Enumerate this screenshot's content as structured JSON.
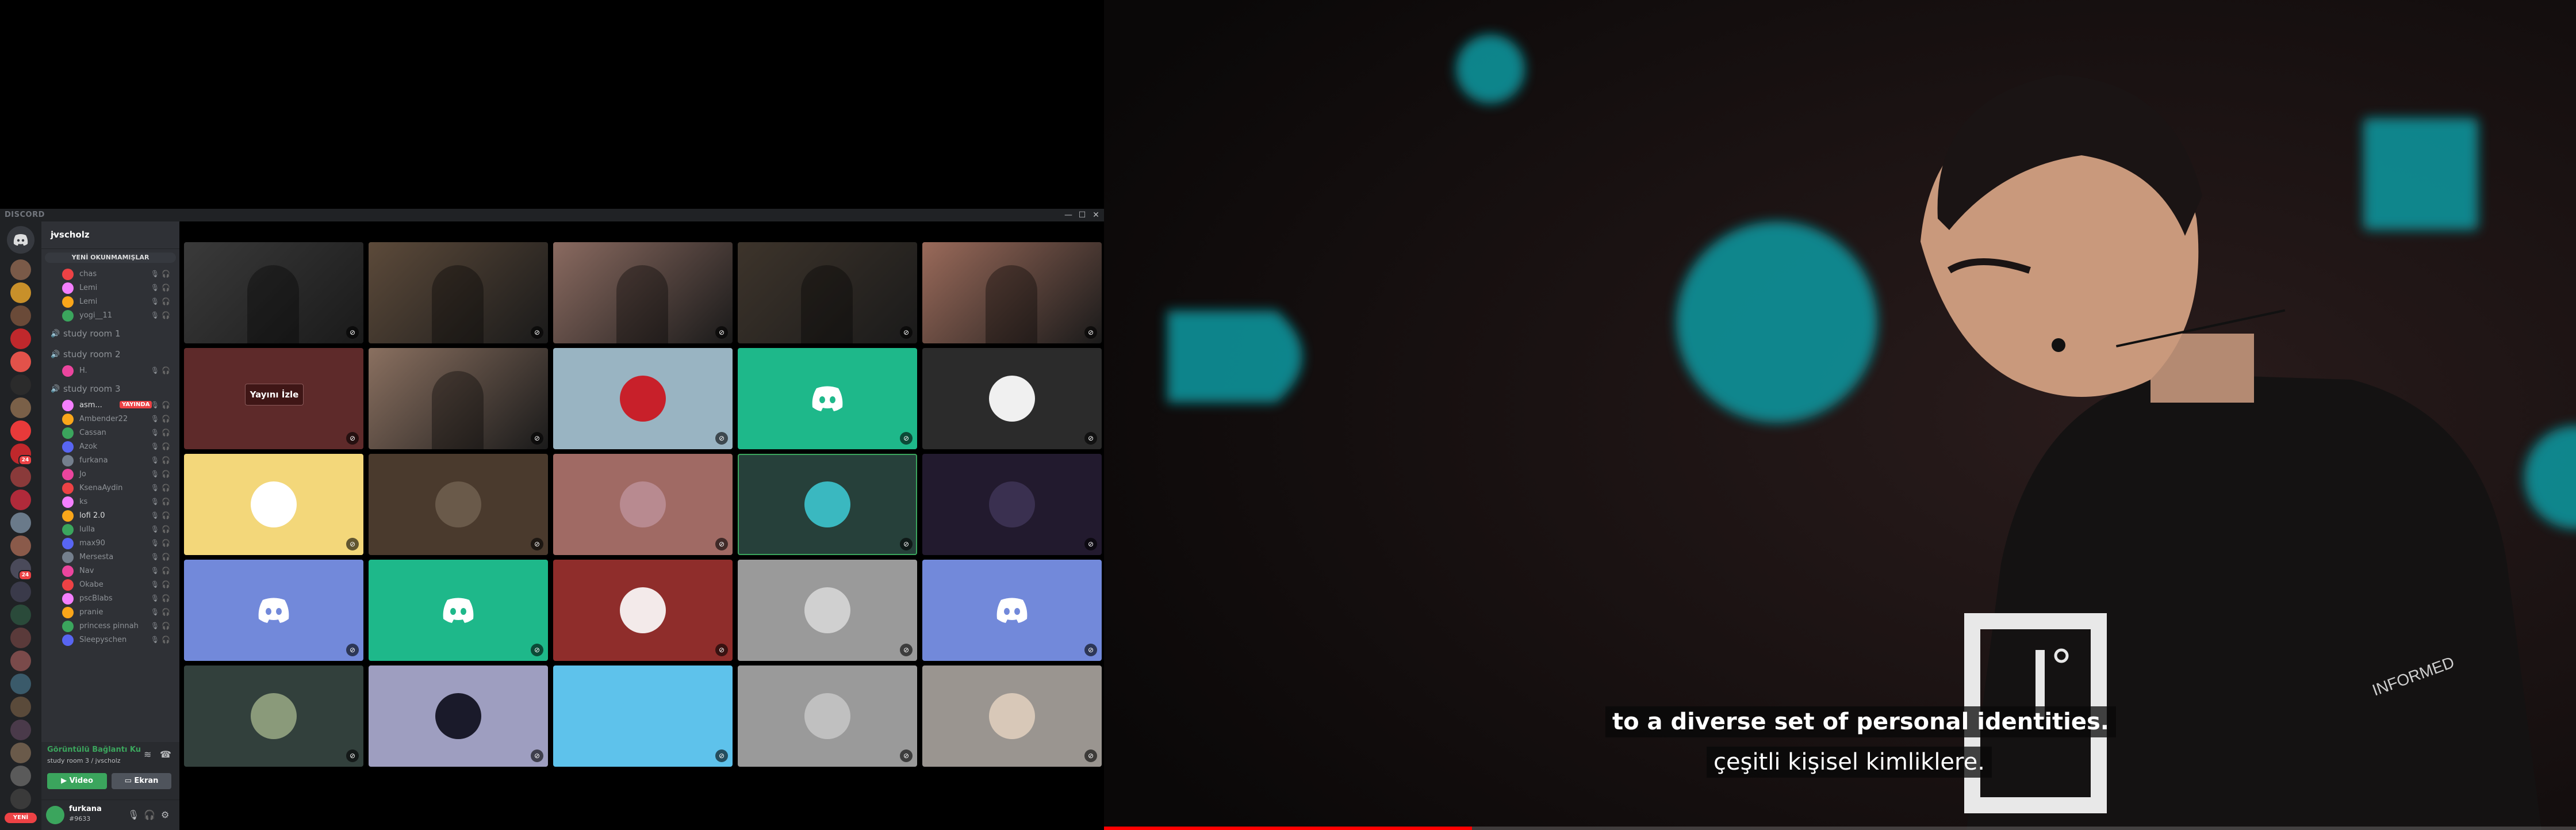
{
  "discord": {
    "app_name": "DISCORD",
    "window_controls": {
      "minimize": "—",
      "maximize": "☐",
      "close": "✕"
    },
    "server": {
      "name": "jvscholz",
      "new_unreads": "YENİ OKUNMAMIŞLAR"
    },
    "rail_badges": [
      "",
      "",
      "",
      "",
      "",
      "",
      "",
      "",
      "24",
      "",
      "",
      "",
      "",
      "24",
      "",
      "",
      "",
      "",
      "",
      "",
      "",
      "",
      "",
      ""
    ],
    "new_label": "YENİ",
    "channels": [
      {
        "type": "user",
        "name": "chas",
        "on": false
      },
      {
        "type": "user",
        "name": "Lemi",
        "on": false
      },
      {
        "type": "user",
        "name": "Lemi",
        "on": false
      },
      {
        "type": "user",
        "name": "yogi__11",
        "on": false
      },
      {
        "type": "voice",
        "name": "study room 1"
      },
      {
        "type": "voice",
        "name": "study room 2"
      },
      {
        "type": "user",
        "name": "H.",
        "on": false
      },
      {
        "type": "voice",
        "name": "study room 3"
      },
      {
        "type": "user",
        "name": "asm...",
        "on": true,
        "live": "YAYINDA"
      },
      {
        "type": "user",
        "name": "Ambender22",
        "on": false
      },
      {
        "type": "user",
        "name": "Cassan",
        "on": false
      },
      {
        "type": "user",
        "name": "Azok",
        "on": false
      },
      {
        "type": "user",
        "name": "furkana",
        "on": false
      },
      {
        "type": "user",
        "name": "Jo",
        "on": false
      },
      {
        "type": "user",
        "name": "KsenaAydin",
        "on": false
      },
      {
        "type": "user",
        "name": "ks",
        "on": false
      },
      {
        "type": "user",
        "name": "lofi 2.0",
        "on": true
      },
      {
        "type": "user",
        "name": "lulla",
        "on": false
      },
      {
        "type": "user",
        "name": "max90",
        "on": false
      },
      {
        "type": "user",
        "name": "Mersesta",
        "on": false
      },
      {
        "type": "user",
        "name": "Nav",
        "on": false
      },
      {
        "type": "user",
        "name": "Okabe",
        "on": false
      },
      {
        "type": "user",
        "name": "pscBlabs",
        "on": false
      },
      {
        "type": "user",
        "name": "pranie",
        "on": false
      },
      {
        "type": "user",
        "name": "princess pinnah",
        "on": false
      },
      {
        "type": "user",
        "name": "Sleepyschen",
        "on": false
      }
    ],
    "voice_panel": {
      "status": "Görüntülü Bağlantı Ku",
      "location": "study room 3 / jvscholz",
      "video_label": "Video",
      "screen_label": "Ekran"
    },
    "user": {
      "name": "furkana",
      "tag": "#9633"
    },
    "watch_label": "Yayını İzle",
    "tiles": [
      {
        "kind": "cam",
        "bg": "#3a3a3a"
      },
      {
        "kind": "cam",
        "bg": "#5c4a3a"
      },
      {
        "kind": "cam",
        "bg": "#8a6a60"
      },
      {
        "kind": "cam",
        "bg": "#3d342b"
      },
      {
        "kind": "cam",
        "bg": "#9a6a5a"
      },
      {
        "kind": "stream",
        "bg": "#5e2a2a"
      },
      {
        "kind": "cam",
        "bg": "#8a7060"
      },
      {
        "kind": "avatar",
        "bg": "#99b4c2",
        "av": "#c8202a"
      },
      {
        "kind": "logo",
        "bg": "#1eb88a"
      },
      {
        "kind": "avatar",
        "bg": "#2b2b2b",
        "av": "#f0f0f0"
      },
      {
        "kind": "avatar",
        "bg": "#f3d77a",
        "av": "#ffffff"
      },
      {
        "kind": "avatar",
        "bg": "#4a3a2d",
        "av": "#6a5a4a"
      },
      {
        "kind": "avatar",
        "bg": "#a06a64",
        "av": "#b88a90"
      },
      {
        "kind": "avatar",
        "bg": "#26403a",
        "av": "#3ab8c0",
        "speaking": true
      },
      {
        "kind": "avatar",
        "bg": "#221a2e",
        "av": "#3a3050"
      },
      {
        "kind": "logo",
        "bg": "#7289da"
      },
      {
        "kind": "logo",
        "bg": "#1eb88a"
      },
      {
        "kind": "avatar",
        "bg": "#8f2d2b",
        "av": "#f3eaea"
      },
      {
        "kind": "avatar",
        "bg": "#9a9a9a",
        "av": "#d0d0d0"
      },
      {
        "kind": "logo",
        "bg": "#7289da"
      },
      {
        "kind": "avatar",
        "bg": "#32403c",
        "av": "#8a9a7a"
      },
      {
        "kind": "avatar",
        "bg": "#9e9ec0",
        "av": "#1a1a2a"
      },
      {
        "kind": "avatar",
        "bg": "#5ec2eb",
        "av": "#5ec2eb"
      },
      {
        "kind": "avatar",
        "bg": "#9a9a9a",
        "av": "#c0c0c0"
      },
      {
        "kind": "avatar",
        "bg": "#9a9590",
        "av": "#d8c8b8"
      }
    ]
  },
  "player": {
    "subtitle_primary": "to a diverse set of personal identities.",
    "subtitle_secondary": "çeşitli kişisel kimliklere.",
    "progress": 0.25
  },
  "colors": {
    "discord_green": "#3ba55d",
    "discord_red": "#ed4245",
    "blurple": "#7289da",
    "youtube_red": "#ff0000"
  }
}
